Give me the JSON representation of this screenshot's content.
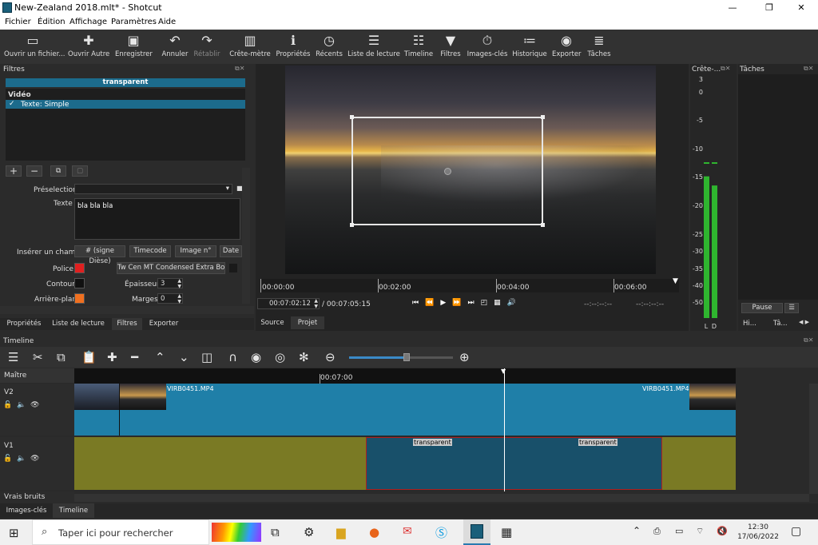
{
  "window": {
    "title": "New-Zealand 2018.mlt* - Shotcut",
    "minimize": "—",
    "maximize": "❐",
    "close": "✕"
  },
  "menu": [
    "Fichier",
    "Édition",
    "Affichage",
    "Paramètres",
    "Aide"
  ],
  "toolbar": [
    {
      "icon": "open-file-icon",
      "label": "Ouvrir un fichier..."
    },
    {
      "icon": "open-other-icon",
      "label": "Ouvrir Autre"
    },
    {
      "icon": "save-icon",
      "label": "Enregistrer"
    },
    {
      "icon": "undo-icon",
      "label": "Annuler"
    },
    {
      "icon": "redo-icon",
      "label": "Rétablir"
    },
    {
      "icon": "peak-meter-icon",
      "label": "Crête-mètre"
    },
    {
      "icon": "properties-icon",
      "label": "Propriétés"
    },
    {
      "icon": "recent-icon",
      "label": "Récents"
    },
    {
      "icon": "playlist-icon",
      "label": "Liste de lecture"
    },
    {
      "icon": "timeline-icon",
      "label": "Timeline"
    },
    {
      "icon": "filters-icon",
      "label": "Filtres"
    },
    {
      "icon": "keyframes-icon",
      "label": "Images-clés"
    },
    {
      "icon": "history-icon",
      "label": "Historique"
    },
    {
      "icon": "export-icon",
      "label": "Exporter"
    },
    {
      "icon": "jobs-icon",
      "label": "Tâches"
    }
  ],
  "filters": {
    "header": "Filtres",
    "clip_name": "transparent",
    "section": "Vidéo",
    "item_check": "✓",
    "item": "Texte: Simple",
    "preset_label": "Préselection",
    "text_label": "Texte",
    "text_value": "bla bla bla",
    "insert_label": "Insérer un champ",
    "insert_buttons": [
      "# (signe Dièse)",
      "Timecode",
      "Image n°",
      "Date d"
    ],
    "font_label": "Police",
    "font_value": "Tw Cen MT Condensed Extra Bold",
    "outline_label": "Contour",
    "thickness_label": "Épaisseur",
    "thickness_value": "3",
    "background_label": "Arrière-plan",
    "margins_label": "Marges",
    "margins_value": "0",
    "colors": {
      "font": "#e02020",
      "outline": "#111111",
      "background": "#f07020"
    }
  },
  "left_tabs": [
    "Propriétés",
    "Liste de lecture",
    "Filtres",
    "Exporter"
  ],
  "player": {
    "ruler": [
      "00:00:00",
      "00:02:00",
      "00:04:00",
      "00:06:00"
    ],
    "position": "00:07:02:12",
    "duration": "/ 00:07:05:15",
    "in_point": "--:--:--:--",
    "out_point": "--:--:--:--",
    "tabs": [
      "Source",
      "Projet"
    ]
  },
  "meter": {
    "header": "Crête-...",
    "scale": [
      "3",
      "0",
      "-5",
      "-10",
      "-15",
      "-20",
      "-25",
      "-30",
      "-35",
      "-40",
      "-50"
    ],
    "channels": [
      "L",
      "D"
    ],
    "levels": [
      0.62,
      0.58
    ]
  },
  "jobs": {
    "header": "Tâches",
    "pause": "Pause",
    "menu": "☰",
    "tabs": [
      "Hi...",
      "Tâ..."
    ]
  },
  "timeline": {
    "header": "Timeline",
    "master": "Maître",
    "ruler_mark": "00:07:00",
    "tracks": [
      {
        "name": "V2",
        "clips": [
          "VIRB0451.MP4",
          "VIRB0451.MP4"
        ]
      },
      {
        "name": "V1",
        "clips": [
          "transparent",
          "transparent"
        ]
      }
    ],
    "audio_track": "Vrais bruits",
    "bottom_tabs": [
      "Images-clés",
      "Timeline"
    ]
  },
  "taskbar": {
    "search_placeholder": "Taper ici pour rechercher",
    "time": "12:30",
    "date": "17/06/2022"
  }
}
